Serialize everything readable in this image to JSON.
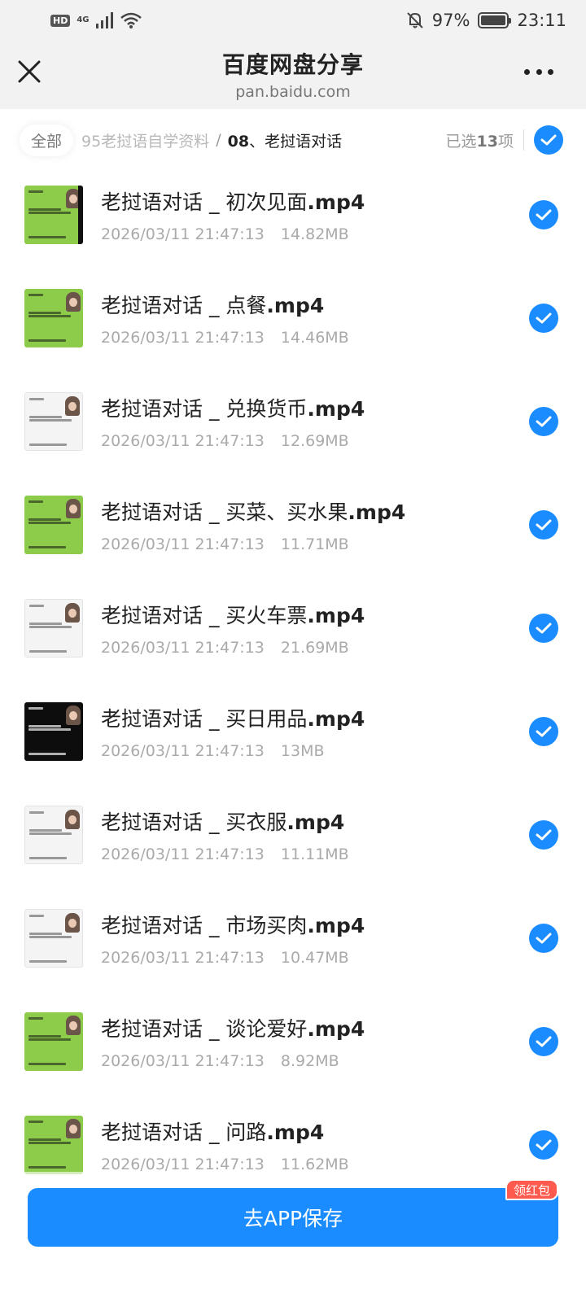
{
  "status_bar": {
    "hd": "HD",
    "network": "4G",
    "battery": "97%",
    "battery_level": 0.97,
    "time": "23:11"
  },
  "header": {
    "title": "百度网盘分享",
    "subtitle": "pan.baidu.com"
  },
  "breadcrumb": {
    "all": "全部",
    "path": "95老挝语自学资料",
    "separator": "/",
    "current_num": "08",
    "current_name": "、老挝语对话",
    "selected_prefix": "已选",
    "selected_count": "13",
    "selected_suffix": "项"
  },
  "files": [
    {
      "name": "老挝语对话 _ 初次见面",
      "ext": ".mp4",
      "date": "2026/03/11 21:47:13",
      "size": "14.82MB",
      "thumb": "green"
    },
    {
      "name": "老挝语对话 _ 点餐",
      "ext": ".mp4",
      "date": "2026/03/11 21:47:13",
      "size": "14.46MB",
      "thumb": "green"
    },
    {
      "name": "老挝语对话 _ 兑换货币",
      "ext": ".mp4",
      "date": "2026/03/11 21:47:13",
      "size": "12.69MB",
      "thumb": "white"
    },
    {
      "name": "老挝语对话 _ 买菜、买水果",
      "ext": ".mp4",
      "date": "2026/03/11 21:47:13",
      "size": "11.71MB",
      "thumb": "green"
    },
    {
      "name": "老挝语对话 _ 买火车票",
      "ext": ".mp4",
      "date": "2026/03/11 21:47:13",
      "size": "21.69MB",
      "thumb": "white"
    },
    {
      "name": "老挝语对话 _ 买日用品",
      "ext": ".mp4",
      "date": "2026/03/11 21:47:13",
      "size": "13MB",
      "thumb": "black"
    },
    {
      "name": "老挝语对话 _ 买衣服",
      "ext": ".mp4",
      "date": "2026/03/11 21:47:13",
      "size": "11.11MB",
      "thumb": "white"
    },
    {
      "name": "老挝语对话 _ 市场买肉",
      "ext": ".mp4",
      "date": "2026/03/11 21:47:13",
      "size": "10.47MB",
      "thumb": "white"
    },
    {
      "name": "老挝语对话 _ 谈论爱好",
      "ext": ".mp4",
      "date": "2026/03/11 21:47:13",
      "size": "8.92MB",
      "thumb": "green"
    },
    {
      "name": "老挝语对话 _ 问路",
      "ext": ".mp4",
      "date": "2026/03/11 21:47:13",
      "size": "11.62MB",
      "thumb": "green"
    }
  ],
  "footer": {
    "save_label": "去APP保存",
    "badge": "领红包"
  },
  "colors": {
    "accent": "#1a8cff",
    "badge": "#ff5a4e"
  }
}
